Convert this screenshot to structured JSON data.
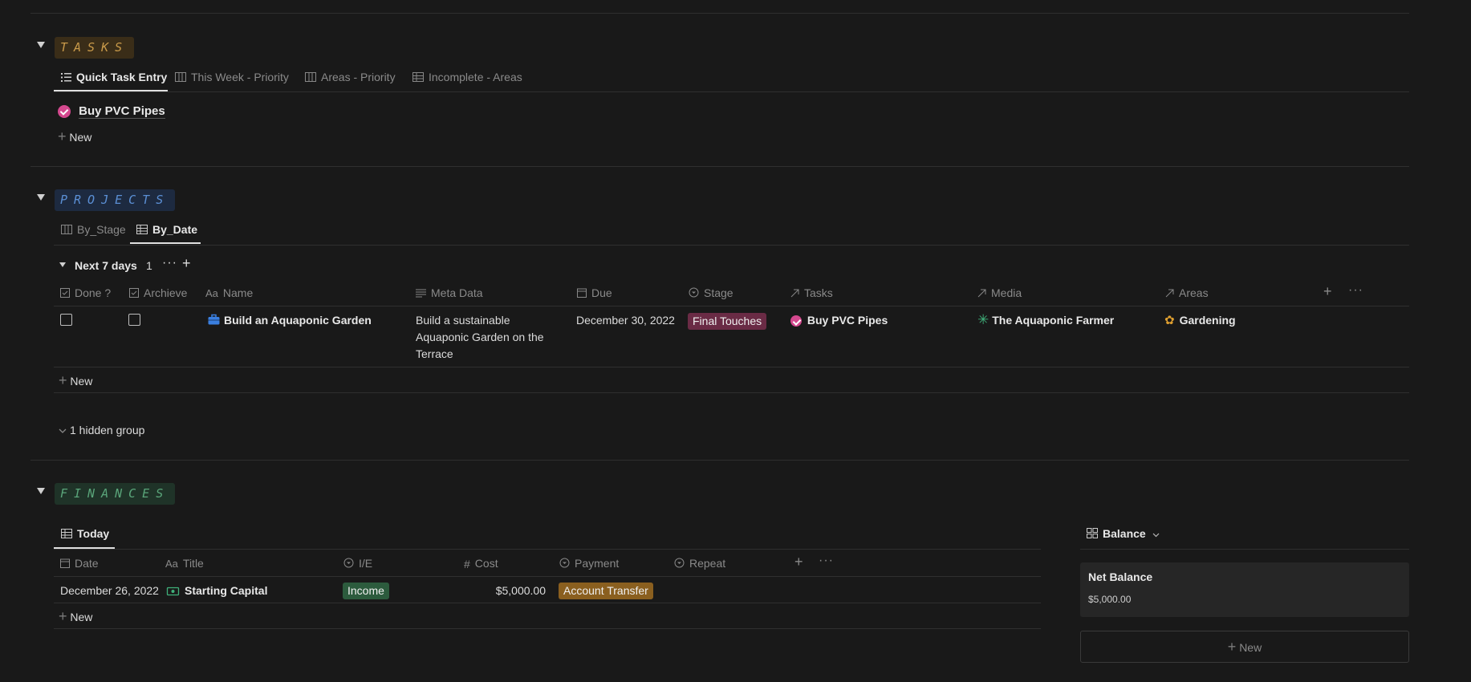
{
  "tasks": {
    "title": "TASKS",
    "tabs": [
      "Quick Task Entry",
      "This Week - Priority",
      "Areas - Priority",
      "Incomplete - Areas"
    ],
    "items": [
      "Buy PVC Pipes"
    ],
    "new_label": "New"
  },
  "projects": {
    "title": "PROJECTS",
    "tabs": [
      "By_Stage",
      "By_Date"
    ],
    "group": {
      "label": "Next 7 days",
      "count": "1"
    },
    "columns": [
      "Done ?",
      "Archieve",
      "Name",
      "Meta Data",
      "Due",
      "Stage",
      "Tasks",
      "Media",
      "Areas"
    ],
    "row": {
      "name": "Build an Aquaponic Garden",
      "meta_line1": "Build a sustainable",
      "meta_line2": "Aquaponic Garden on the",
      "meta_line3": "Terrace",
      "due": "December 30, 2022",
      "stage": "Final Touches",
      "task": "Buy PVC Pipes",
      "media": "The Aquaponic Farmer",
      "area": "Gardening"
    },
    "new_label": "New",
    "hidden_group": "1 hidden group"
  },
  "finances": {
    "title": "FINANCES",
    "tab": "Today",
    "columns": [
      "Date",
      "Title",
      "I/E",
      "Cost",
      "Payment",
      "Repeat"
    ],
    "row": {
      "date": "December 26, 2022",
      "title": "Starting Capital",
      "ie": "Income",
      "cost": "$5,000.00",
      "payment": "Account Transfer"
    },
    "new_label": "New",
    "balance": {
      "view_label": "Balance",
      "card_title": "Net Balance",
      "card_value": "$5,000.00",
      "new_label": "New"
    }
  },
  "colors": {
    "tasks_title": "#c99a4a",
    "projects_title": "#5b8fd4",
    "finances_title": "#5aa57a",
    "stage_tag": "#6a2b45",
    "income_tag": "#2c5b3d",
    "payment_tag": "#8a5f1f"
  }
}
